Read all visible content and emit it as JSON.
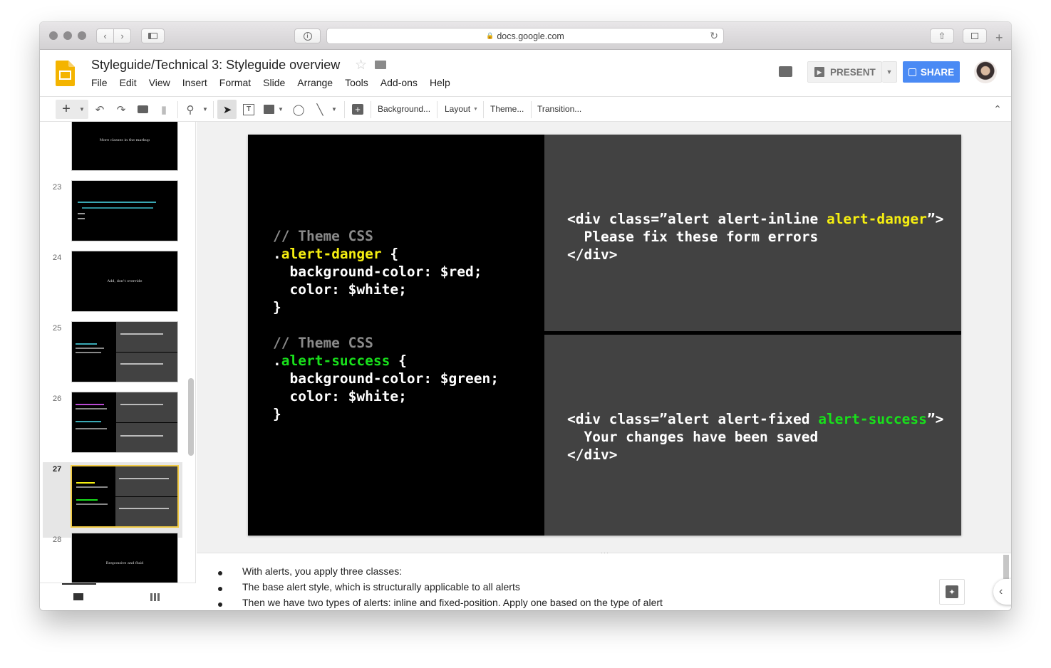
{
  "browser": {
    "url": "docs.google.com"
  },
  "doc": {
    "title": "Styleguide/Technical 3: Styleguide overview",
    "menu": [
      "File",
      "Edit",
      "View",
      "Insert",
      "Format",
      "Slide",
      "Arrange",
      "Tools",
      "Add-ons",
      "Help"
    ],
    "present_label": "PRESENT",
    "share_label": "SHARE"
  },
  "toolbar": {
    "background": "Background...",
    "layout": "Layout",
    "theme": "Theme...",
    "transition": "Transition..."
  },
  "filmstrip": [
    {
      "num": "",
      "caption": "More classes in the markup"
    },
    {
      "num": "23",
      "caption": ""
    },
    {
      "num": "24",
      "caption": "Add, don't override"
    },
    {
      "num": "25",
      "caption": ""
    },
    {
      "num": "26",
      "caption": ""
    },
    {
      "num": "27",
      "caption": "",
      "selected": true
    },
    {
      "num": "28",
      "caption": "Responsive and fluid"
    }
  ],
  "slide": {
    "left_code": {
      "comment1": "// Theme CSS",
      "selector1_dot": ".",
      "selector1": "alert-danger",
      "brace_open": " {",
      "rule1a": "  background-color: $red;",
      "rule1b": "  color: $white;",
      "brace_close": "}",
      "comment2": "// Theme CSS",
      "selector2_dot": ".",
      "selector2": "alert-success",
      "rule2a": "  background-color: $green;",
      "rule2b": "  color: $white;"
    },
    "top_code": {
      "open_prefix": "<div class=”alert alert-inline ",
      "open_highlight": "alert-danger",
      "open_suffix": "”>",
      "body": "  Please fix these form errors",
      "close": "</div>"
    },
    "bottom_code": {
      "open_prefix": "<div class=”alert alert-fixed ",
      "open_highlight": "alert-success",
      "open_suffix": "”>",
      "body": "  Your changes have been saved",
      "close": "</div>"
    }
  },
  "notes": [
    "With alerts, you apply three classes:",
    "The base alert style, which is structurally applicable to all alerts",
    "Then we have two types of alerts: inline and fixed-position. Apply one based on the type of alert"
  ],
  "colors": {
    "accent_blue": "#4a8af4",
    "code_yellow": "#f5ee11",
    "code_green": "#18e01b",
    "selection": "#f0ca45"
  }
}
